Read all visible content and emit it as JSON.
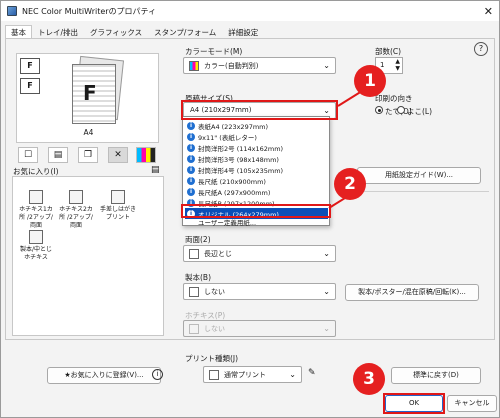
{
  "window": {
    "title": "NEC Color MultiWriterのプロパティ",
    "close": "✕"
  },
  "tabs": [
    "基本",
    "トレイ/排出",
    "グラフィックス",
    "スタンプ/フォーム",
    "詳細設定"
  ],
  "help": "?",
  "preview": {
    "paper_label": "A4",
    "page_letter": "F"
  },
  "favorites": {
    "label": "お気に入り(I)",
    "items": [
      "ホチキス1カ所 /2アップ/両面",
      "ホチキス2カ所 /2アップ/両面",
      "手差しはがき プリント",
      "製本/中とじ ホチキス"
    ]
  },
  "color_mode": {
    "label": "カラーモード(M)",
    "value": "カラー(自動判別)"
  },
  "copies": {
    "label": "部数(C)",
    "value": "1"
  },
  "paper_size": {
    "label": "原稿サイズ(S)",
    "value": "A4 (210x297mm)"
  },
  "orientation": {
    "label": "印刷の向き",
    "options": [
      "たて(O)",
      "よこ(L)"
    ],
    "selected": 0
  },
  "dropdown_items": [
    "表紙A4 (223x297mm)",
    "9x11\" (表紙レター)",
    "封筒洋形2号 (114x162mm)",
    "封筒洋形3号 (98x148mm)",
    "封筒洋形4号 (105x235mm)",
    "長尺紙 (210x900mm)",
    "長尺紙A (297x900mm)",
    "長尺紙B (297x1200mm)",
    "オリジナル (264x279mm)",
    "ユーザー定義用紙..."
  ],
  "dropdown_selected_index": 8,
  "paper_settings_button": "用紙設定ガイド(W)...",
  "duplex": {
    "label": "両面(2)",
    "value": "長辺とじ"
  },
  "booklet": {
    "label": "製本(B)",
    "value": "しない",
    "button": "製本/ポスター/混在原稿/回転(K)..."
  },
  "staple": {
    "label": "ホチキス(P)",
    "value": "しない"
  },
  "bottom": {
    "add_favorite": "お気に入りに登録(V)...",
    "print_type_label": "プリント種類(J)",
    "print_type_value": "通常プリント",
    "reset": "標準に戻す(D)",
    "ok": "OK",
    "cancel": "キャンセル"
  },
  "callouts": [
    "1",
    "2",
    "3"
  ],
  "colors": {
    "accent": "#0a4fb8",
    "callout": "#e52020"
  }
}
